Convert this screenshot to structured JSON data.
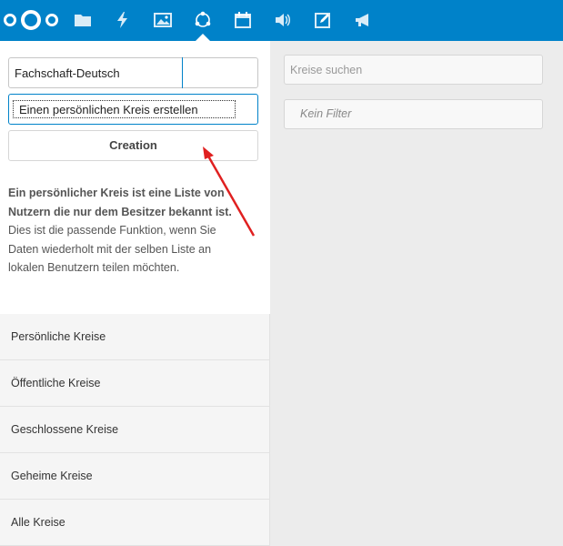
{
  "topbar": {
    "accent_color": "#0082c9",
    "logo": "nextcloud-logo",
    "icons": [
      "files-icon",
      "activity-icon",
      "gallery-icon",
      "circles-icon",
      "calendar-icon",
      "audio-icon",
      "notes-icon",
      "announcements-icon"
    ],
    "active": "circles-icon"
  },
  "create": {
    "name_value": "Fachschaft-Deutsch",
    "type_selected": "Einen persönlichen Kreis erstellen",
    "creation_label": "Creation",
    "desc_bold": "Ein persönlicher Kreis ist eine Liste von Nutzern die nur dem Besitzer bekannt ist.",
    "desc_text": "Dies ist die passende Funktion, wenn Sie Daten wiederholt mit der selben Liste an lokalen Benutzern teilen möchten."
  },
  "filters": [
    {
      "label": "Persönliche Kreise"
    },
    {
      "label": "Öffentliche Kreise"
    },
    {
      "label": "Geschlossene Kreise"
    },
    {
      "label": "Geheime Kreise"
    },
    {
      "label": "Alle Kreise"
    }
  ],
  "right": {
    "search_placeholder": "Kreise suchen",
    "filter_selected": "Kein Filter"
  },
  "annotation_arrow_color": "#e02020"
}
